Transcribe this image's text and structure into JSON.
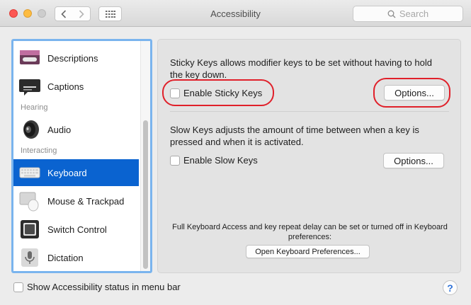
{
  "window": {
    "title": "Accessibility",
    "search_placeholder": "Search"
  },
  "sidebar": {
    "items": [
      {
        "label": "Descriptions",
        "icon": "descriptions-icon",
        "selected": false
      },
      {
        "label": "Captions",
        "icon": "captions-icon",
        "selected": false
      },
      {
        "label": "Audio",
        "icon": "speaker-icon",
        "selected": false
      },
      {
        "label": "Keyboard",
        "icon": "keyboard-icon",
        "selected": true
      },
      {
        "label": "Mouse & Trackpad",
        "icon": "mouse-trackpad-icon",
        "selected": false
      },
      {
        "label": "Switch Control",
        "icon": "switch-control-icon",
        "selected": false
      },
      {
        "label": "Dictation",
        "icon": "microphone-icon",
        "selected": false
      }
    ],
    "sections": {
      "hearing": "Hearing",
      "interacting": "Interacting"
    }
  },
  "main": {
    "sticky_keys": {
      "description": "Sticky Keys allows modifier keys to be set without having to hold the key down.",
      "checkbox_label": "Enable Sticky Keys",
      "checked": false,
      "options_label": "Options..."
    },
    "slow_keys": {
      "description": "Slow Keys adjusts the amount of time between when a key is pressed and when it is activated.",
      "checkbox_label": "Enable Slow Keys",
      "checked": false,
      "options_label": "Options..."
    },
    "keyboard_access_note": "Full Keyboard Access and key repeat delay can be set or turned off in Keyboard preferences:",
    "open_prefs_label": "Open Keyboard Preferences..."
  },
  "footer": {
    "status_checkbox_label": "Show Accessibility status in menu bar",
    "status_checked": false,
    "help_label": "?"
  },
  "colors": {
    "selection": "#0a63d0",
    "highlight_ring": "#e0202a",
    "focus_ring": "#7ab4ee"
  }
}
